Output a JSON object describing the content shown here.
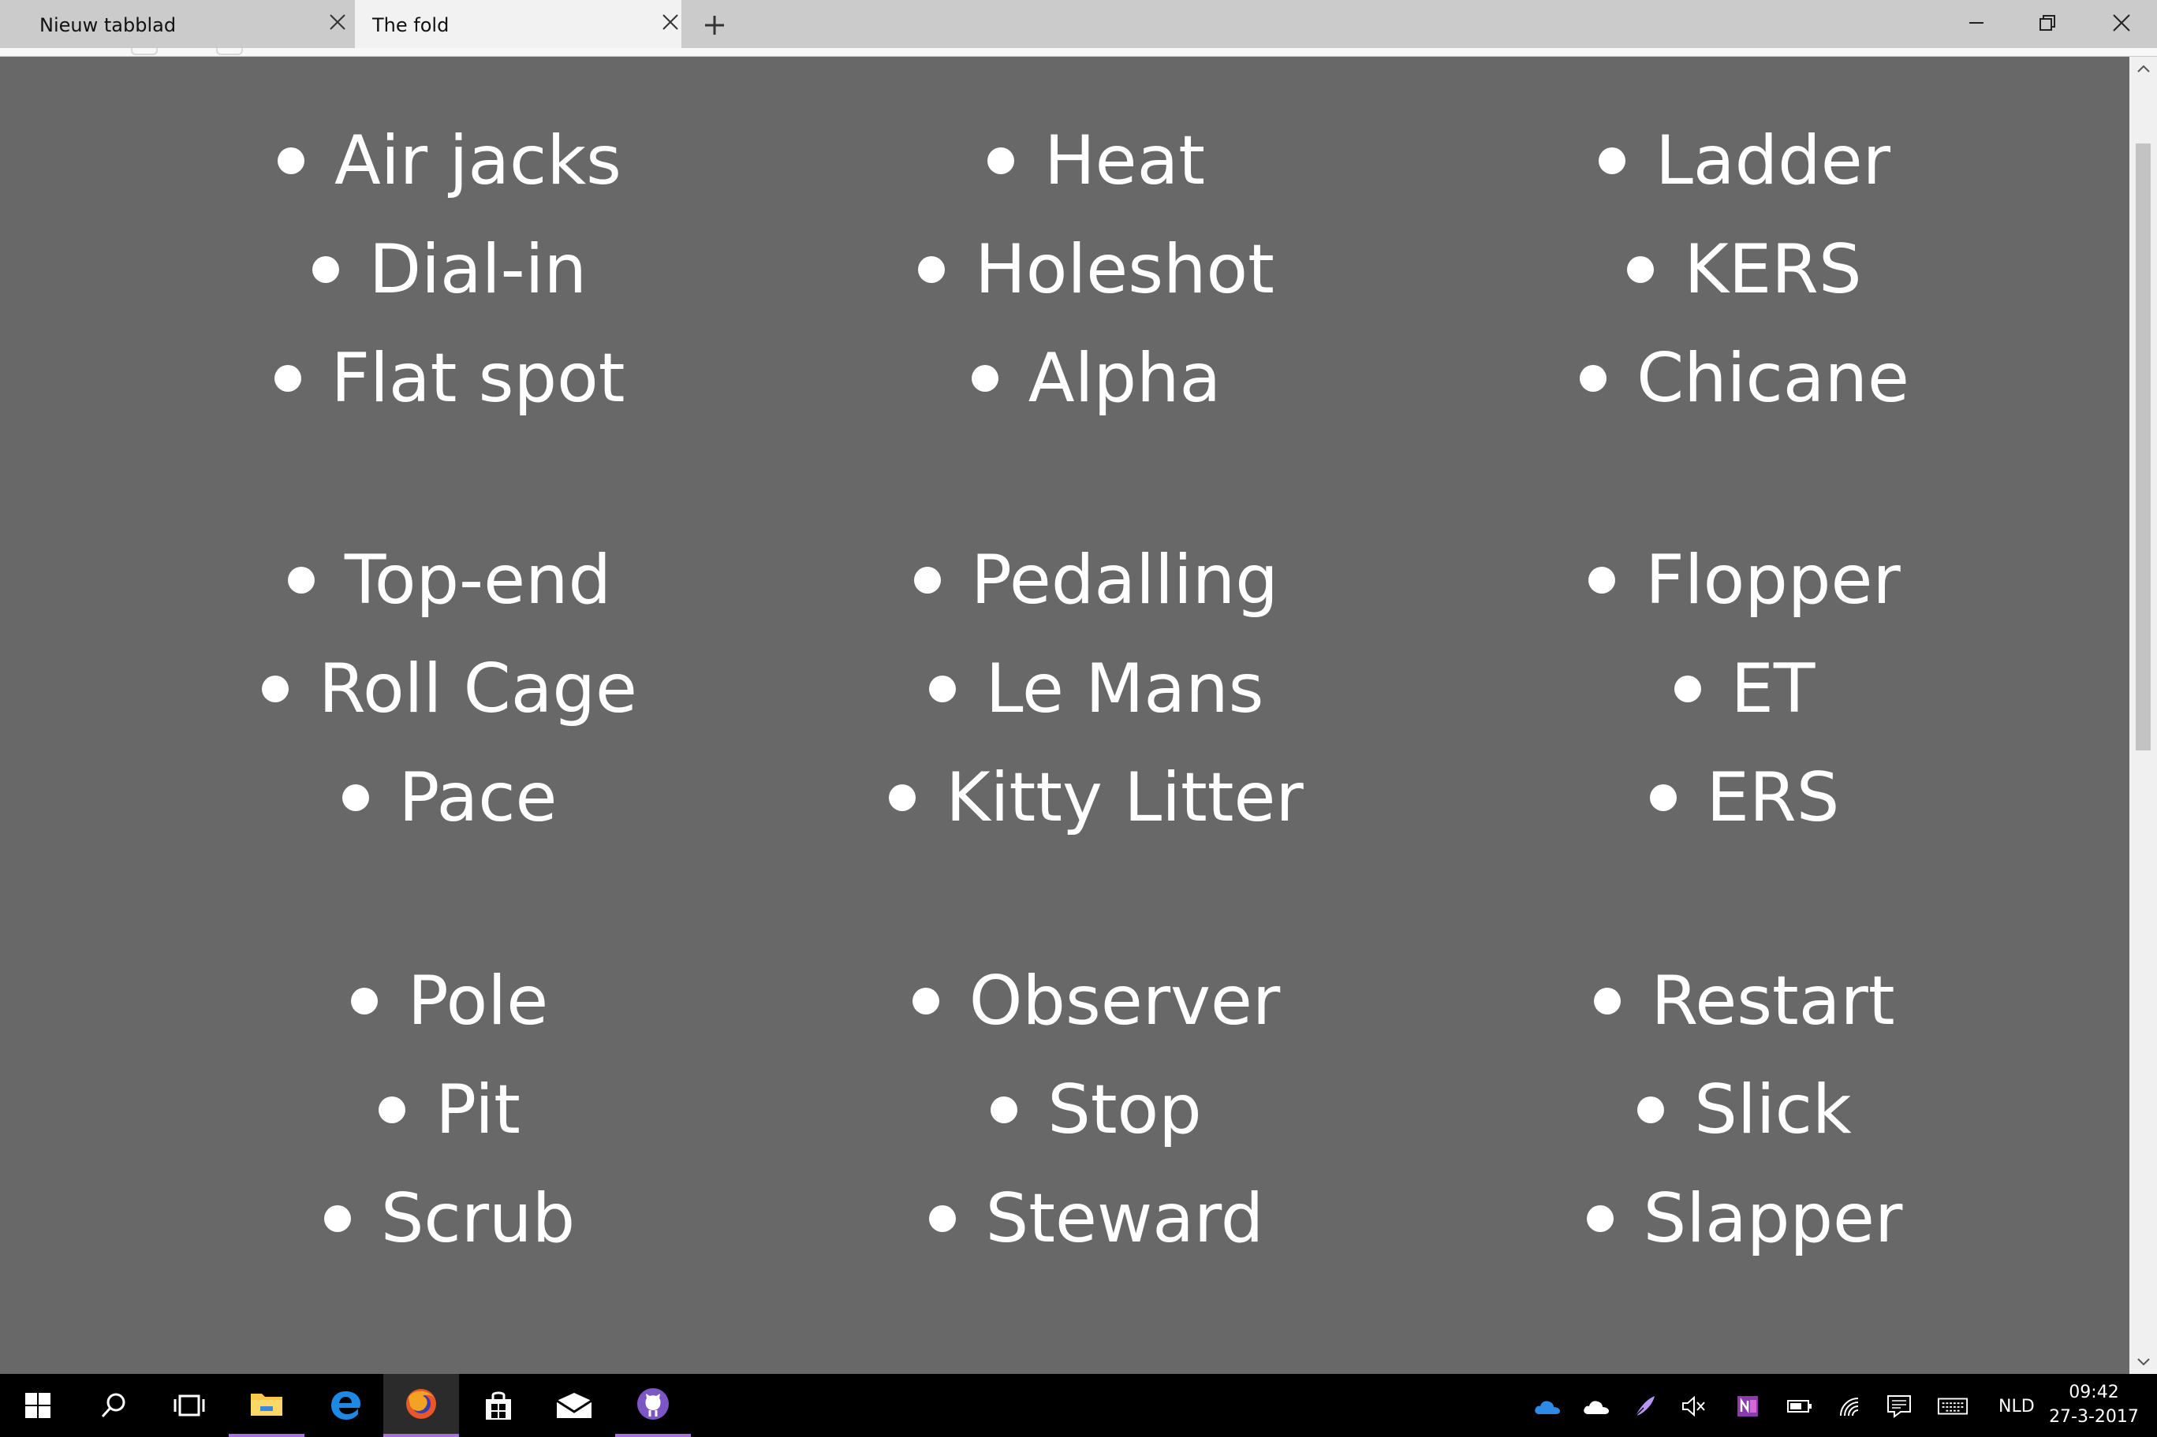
{
  "browser": {
    "tabs": [
      {
        "title": "Nieuw tabblad",
        "active": false
      },
      {
        "title": "The fold",
        "active": true
      }
    ]
  },
  "page": {
    "background": "#686868",
    "text_color": "#ffffff",
    "groups": [
      {
        "column": 0,
        "row": 0,
        "items": [
          "Air jacks",
          "Dial-in",
          "Flat spot"
        ]
      },
      {
        "column": 1,
        "row": 0,
        "items": [
          "Heat",
          "Holeshot",
          "Alpha"
        ]
      },
      {
        "column": 2,
        "row": 0,
        "items": [
          "Ladder",
          "KERS",
          "Chicane"
        ]
      },
      {
        "column": 0,
        "row": 1,
        "items": [
          "Top-end",
          "Roll Cage",
          "Pace"
        ]
      },
      {
        "column": 1,
        "row": 1,
        "items": [
          "Pedalling",
          "Le Mans",
          "Kitty Litter"
        ]
      },
      {
        "column": 2,
        "row": 1,
        "items": [
          "Flopper",
          "ET",
          "ERS"
        ]
      },
      {
        "column": 0,
        "row": 2,
        "items": [
          "Pole",
          "Pit",
          "Scrub"
        ]
      },
      {
        "column": 1,
        "row": 2,
        "items": [
          "Observer",
          "Stop",
          "Steward"
        ]
      },
      {
        "column": 2,
        "row": 2,
        "items": [
          "Restart",
          "Slick",
          "Slapper"
        ]
      }
    ]
  },
  "taskbar": {
    "apps": [
      {
        "icon": "windows-start-icon"
      },
      {
        "icon": "search-icon"
      },
      {
        "icon": "task-view-icon"
      },
      {
        "icon": "file-explorer-icon"
      },
      {
        "icon": "edge-icon"
      },
      {
        "icon": "firefox-icon"
      },
      {
        "icon": "store-icon"
      },
      {
        "icon": "mail-icon"
      },
      {
        "icon": "github-icon"
      }
    ],
    "language": "NLD",
    "time": "09:42",
    "date": "27-3-2017"
  }
}
